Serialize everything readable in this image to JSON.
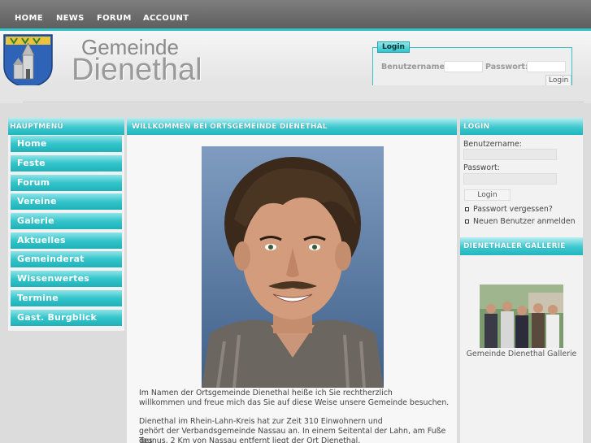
{
  "topnav": {
    "items": [
      {
        "label": "HOME"
      },
      {
        "label": "NEWS"
      },
      {
        "label": "FORUM"
      },
      {
        "label": "ACCOUNT"
      }
    ]
  },
  "header": {
    "title_line1": "Gemeinde",
    "title_line2": "Dienethal",
    "login": {
      "legend": "Login",
      "username_label": "Benutzername:",
      "password_label": "Passwort:",
      "button": "Login"
    }
  },
  "left_menu": {
    "title": "HAUPTMENÜ",
    "items": [
      {
        "label": "Home"
      },
      {
        "label": "Feste"
      },
      {
        "label": "Forum"
      },
      {
        "label": "Vereine"
      },
      {
        "label": "Galerie"
      },
      {
        "label": "Aktuelles"
      },
      {
        "label": "Gemeinderat"
      },
      {
        "label": "Wissenwertes"
      },
      {
        "label": "Termine"
      },
      {
        "label": "Gast. Burgblick"
      }
    ]
  },
  "main": {
    "title": "WILLKOMMEN BEI ORTSGEMEINDE DIENETHAL",
    "paragraph1_line1": "Im Namen der Ortsgemeinde Dienethal heiße ich Sie rechtherzlich",
    "paragraph1_line2": "willkommen und freue mich das Sie auf diese Weise unsere Gemeinde besuchen.",
    "paragraph2_line1": "Dienethal im Rhein-Lahn-Kreis hat zur Zeit 310 Einwohnern und",
    "paragraph2_line2": "gehört der Verbandsgemeinde Nassau an. In einem Seitental der Lahn, am Fuße des",
    "paragraph2_line3": "Taunus, 2 Km von Nassau entfernt liegt der Ort Dienethal."
  },
  "right": {
    "login_title": "LOGIN",
    "username_label": "Benutzername:",
    "password_label": "Passwort:",
    "login_button": "Login",
    "forgot_password": "Passwort vergessen?",
    "register": "Neuen Benutzer anmelden",
    "gallery_title": "DIENETHALER GALLERIE",
    "gallery_caption": "Gemeinde Dienethal Gallerie"
  },
  "colors": {
    "accent": "#31c4cc",
    "nav_bg": "#6e6e6e",
    "page_bg": "#dcdcdc"
  }
}
